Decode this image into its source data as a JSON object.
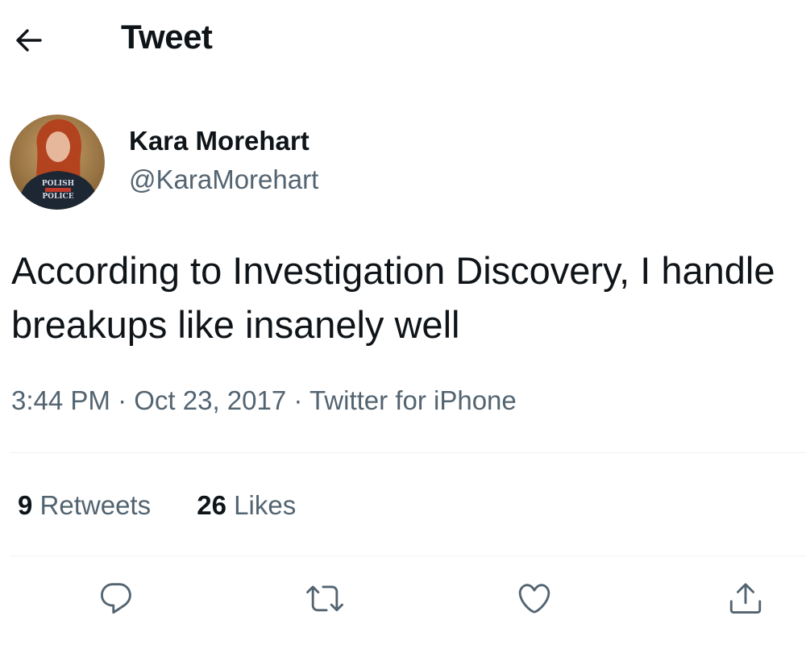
{
  "header": {
    "back_icon": "arrow-left-icon",
    "title": "Tweet"
  },
  "author": {
    "name": "Kara Morehart",
    "handle": "@KaraMorehart",
    "avatar_shirt_text": [
      "POLISH",
      "POLICE"
    ]
  },
  "tweet": {
    "text": "According to Investigation Discovery, I handle breakups like insanely well",
    "time": "3:44 PM",
    "separator": "·",
    "date": "Oct 23, 2017",
    "source": "Twitter for iPhone"
  },
  "stats": {
    "retweets_count": "9",
    "retweets_label": "Retweets",
    "likes_count": "26",
    "likes_label": "Likes"
  },
  "actions": [
    {
      "name": "reply",
      "icon": "reply-icon"
    },
    {
      "name": "retweet",
      "icon": "retweet-icon"
    },
    {
      "name": "like",
      "icon": "heart-icon"
    },
    {
      "name": "share",
      "icon": "share-icon"
    }
  ],
  "colors": {
    "text_primary": "#0f1419",
    "text_secondary": "#536471",
    "divider": "#eff3f4"
  }
}
